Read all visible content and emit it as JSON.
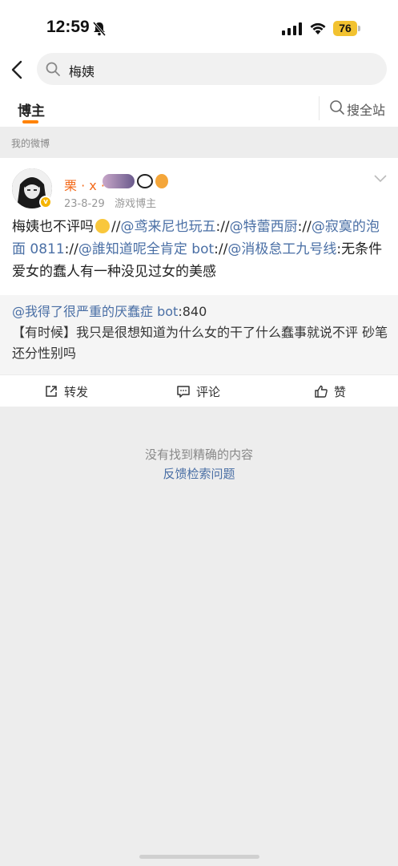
{
  "status_bar": {
    "time": "12:59",
    "battery": "76"
  },
  "header": {
    "search_query": "梅姨"
  },
  "tabs": {
    "active": "博主",
    "search_all": "搜全站"
  },
  "section": {
    "label": "我的微博"
  },
  "post": {
    "username": "栗 · x ·",
    "date": "23-8-29",
    "source": "游戏博主",
    "text_start": "梅姨也不评吗",
    "sep": "//",
    "mentions": [
      "@鸢来尼也玩五",
      "@特蕾西厨",
      "@寂寞的泡面 0811",
      "@誰知道呢全肯定 bot",
      "@消极怠工九号线"
    ],
    "text_end": ":无条件爱女的蠢人有一种没见过女的美感",
    "repost_author": "@我得了很严重的厌蠢症 bot",
    "repost_colon_suffix": ":840",
    "repost_text": "【有时候】我只是很想知道为什么女的干了什么蠢事就说不评 砂笔还分性别吗"
  },
  "actions": {
    "repost": "转发",
    "comment": "评论",
    "like": "赞"
  },
  "empty_note": "没有找到精确的内容",
  "feedback_link": "反馈检索问题",
  "colors": {
    "accent_orange": "#ff8200",
    "username_orange": "#f36b1c",
    "link_blue": "#4a6fa5"
  },
  "icons": [
    "bell-muted-icon",
    "signal-icon",
    "wifi-icon",
    "back-icon",
    "search-icon",
    "chevron-down-icon",
    "repost-icon",
    "comment-icon",
    "like-icon"
  ]
}
